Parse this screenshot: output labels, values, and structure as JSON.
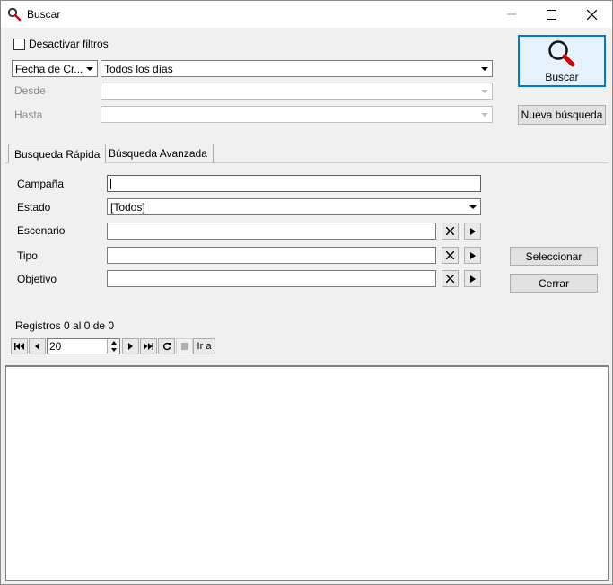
{
  "window": {
    "title": "Buscar",
    "icon": "search-icon",
    "controls": {
      "minimize": "minimize-icon",
      "maximize": "maximize-icon",
      "close": "close-icon"
    }
  },
  "filters": {
    "disable_label": "Desactivar filtros",
    "disable_checked": false,
    "field_value": "Fecha de Cr...",
    "range_value": "Todos los días",
    "desde_label": "Desde",
    "hasta_label": "Hasta",
    "desde_value": "",
    "hasta_value": ""
  },
  "buttons": {
    "buscar": "Buscar",
    "nueva": "Nueva búsqueda",
    "seleccionar": "Seleccionar",
    "cerrar": "Cerrar"
  },
  "tabs": [
    {
      "label": "Busqueda Rápida",
      "active": true
    },
    {
      "label": "Búsqueda Avanzada",
      "active": false
    }
  ],
  "form": {
    "campana_label": "Campaña",
    "campana_value": "",
    "estado_label": "Estado",
    "estado_value": "[Todos]",
    "escenario_label": "Escenario",
    "tipo_label": "Tipo",
    "objetivo_label": "Objetivo"
  },
  "pager": {
    "records_text": "Registros 0 al 0 de 0",
    "page_size": "20",
    "goto_label": "Ir a"
  },
  "colors": {
    "accent": "#0078d7",
    "icon_red": "#d00000"
  }
}
